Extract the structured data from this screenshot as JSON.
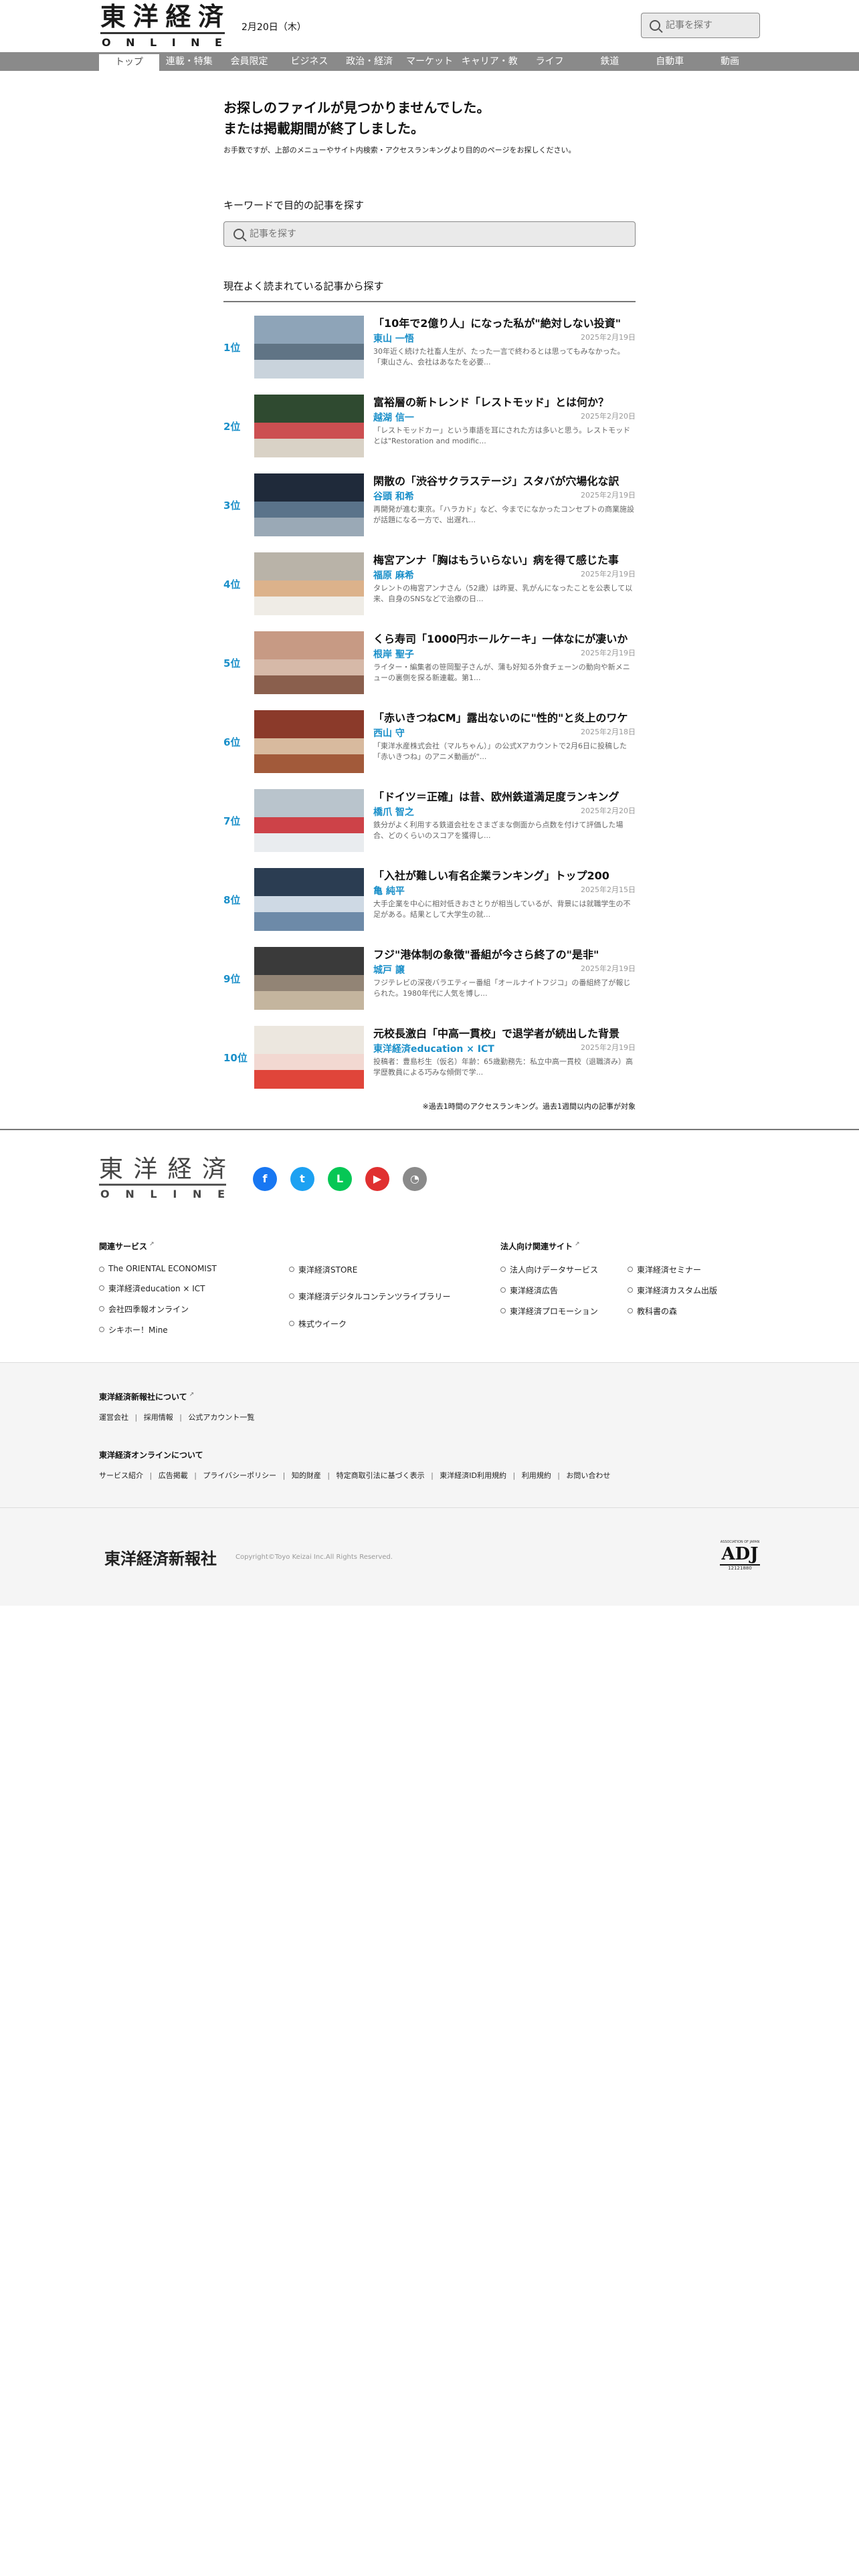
{
  "header": {
    "logo_kanji": [
      "東",
      "洋",
      "経",
      "済"
    ],
    "logo_latin": [
      "O",
      "N",
      "L",
      "I",
      "N",
      "E"
    ],
    "date": "2月20日（木）",
    "search_placeholder": "記事を探す"
  },
  "nav": {
    "items": [
      "トップ",
      "連載・特集",
      "会員限定",
      "ビジネス",
      "政治・経済",
      "マーケット",
      "キャリア・教育",
      "ライフ",
      "鉄道",
      "自動車",
      "動画"
    ],
    "active": 0
  },
  "main": {
    "error_title_1": "お探しのファイルが見つかりませんでした。",
    "error_title_2": "または掲載期間が終了しました。",
    "error_desc": "お手数ですが、上部のメニューやサイト内検索・アクセスランキングより目的のページをお探しください。",
    "keyword_title": "キーワードで目的の記事を探す",
    "search_placeholder": "記事を探す",
    "ranking_title": "現在よく読まれている記事から探す",
    "ranking_note": "※過去1時間のアクセスランキング。過去1週間以内の記事が対象"
  },
  "ranking": [
    {
      "rank": "1位",
      "title": "「10年で2億り人」になった私が\"絶対しない投資\"",
      "author": "東山 一悟",
      "date": "2025年2月19日",
      "excerpt": "30年近く続けた社畜人生が、たった一言で終わるとは思ってもみなかった。「東山さん、会社はあなたを必要...",
      "colors": [
        "#8ea4b8",
        "#4e6376",
        "#c9d3dc"
      ]
    },
    {
      "rank": "2位",
      "title": "富裕層の新トレンド「レストモッド」とは何か？",
      "author": "越湖 信一",
      "date": "2025年2月20日",
      "excerpt": "「レストモッドカー」という車語を耳にされた方は多いと思う。レストモッドとは\"Restoration and modific...",
      "colors": [
        "#2f4a30",
        "#c9383c",
        "#d9d2c6"
      ]
    },
    {
      "rank": "3位",
      "title": "閑散の「渋谷サクラステージ」スタバが穴場化な訳",
      "author": "谷頭 和希",
      "date": "2025年2月19日",
      "excerpt": "再開発が進む東京。「ハラカド」など、今までになかったコンセプトの商業施設が話題になる一方で、出遅れ...",
      "colors": [
        "#1f2a3a",
        "#4f6a82",
        "#9aa9b6"
      ]
    },
    {
      "rank": "4位",
      "title": "梅宮アンナ「胸はもういらない」病を得て感じた事",
      "author": "福原 麻希",
      "date": "2025年2月19日",
      "excerpt": "タレントの梅宮アンナさん（52歳）は昨夏、乳がんになったことを公表して以来、自身のSNSなどで治療の日...",
      "colors": [
        "#b9b3a8",
        "#d8a87a",
        "#efece6"
      ]
    },
    {
      "rank": "5位",
      "title": "くら寿司「1000円ホールケーキ」一体なにが凄いか",
      "author": "根岸 聖子",
      "date": "2025年2月19日",
      "excerpt": "ライター・編集者の笹岡聖子さんが、蒲も好知る外食チェーンの動向や新メニューの裏側を探る新連載。第1...",
      "colors": [
        "#c79a84",
        "#e3c9b9",
        "#8a5f4d"
      ]
    },
    {
      "rank": "6位",
      "title": "「赤いきつねCM」露出ないのに\"性的\"と炎上のワケ",
      "author": "西山 守",
      "date": "2025年2月18日",
      "excerpt": "「東洋水産株式会社（マルちゃん）」の公式Xアカウントで2月6日に投稿した「赤いきつね」のアニメ動画が\"...",
      "colors": [
        "#8b3a2a",
        "#e2cbb0",
        "#a25a3a"
      ]
    },
    {
      "rank": "7位",
      "title": "「ドイツ＝正確」は昔、欧州鉄道満足度ランキング",
      "author": "橋爪 智之",
      "date": "2025年2月20日",
      "excerpt": "鉄分がよく利用する鉄道会社をさまざまな側面から点数を付けて評価した場合、どのくらいのスコアを獲得し...",
      "colors": [
        "#b9c4cc",
        "#c8242a",
        "#e9ecef"
      ]
    },
    {
      "rank": "8位",
      "title": "「入社が難しい有名企業ランキング」トップ200",
      "author": "亀 純平",
      "date": "2025年2月15日",
      "excerpt": "大手企業を中心に相対低きおさとりが相当しているが、背景には就職学生の不足がある。結果として大学生の就...",
      "colors": [
        "#2b3d52",
        "#dfe6ee",
        "#6d8aa8"
      ]
    },
    {
      "rank": "9位",
      "title": "フジ\"港体制の象徴\"番組が今さら終了の\"是非\"",
      "author": "城戸 譲",
      "date": "2025年2月19日",
      "excerpt": "フジテレビの深夜バラエティー番組「オールナイトフジコ」の番組終了が報じられた。1980年代に人気を博し...",
      "colors": [
        "#3a3a3a",
        "#8a7b6d",
        "#c4b59e"
      ]
    },
    {
      "rank": "10位",
      "title": "元校長激白「中高一貫校」で退学者が続出した背景",
      "author": "東洋経済education × ICT",
      "date": "2025年2月19日",
      "excerpt": "投稿者：豊島杉生（仮名）年齢：65歳勤務先：私立中高一貫校（退職済み）高学歴教員による巧みな傾倒で学...",
      "colors": [
        "#ece7df",
        "#f5f2ec",
        "#e0453a"
      ]
    }
  ],
  "footer": {
    "logo_kanji": [
      "東",
      "洋",
      "経",
      "済"
    ],
    "logo_latin": [
      "O",
      "N",
      "L",
      "I",
      "N",
      "E"
    ],
    "social": [
      {
        "icon": "facebook-icon",
        "glyph": "f",
        "color": "#1877f2"
      },
      {
        "icon": "twitter-icon",
        "glyph": "t",
        "color": "#1da1f2"
      },
      {
        "icon": "line-icon",
        "glyph": "L",
        "color": "#06c755"
      },
      {
        "icon": "youtube-icon",
        "glyph": "▶",
        "color": "#e03030"
      },
      {
        "icon": "rss-icon",
        "glyph": "◔",
        "color": "#8a8a8a"
      }
    ],
    "related_title": "関連サービス",
    "related_col1": [
      "The ORIENTAL ECONOMIST",
      "東洋経済education × ICT",
      "会社四季報オンライン",
      "シキホー！Mine"
    ],
    "related_col2": [
      "東洋経済STORE",
      "東洋経済デジタルコンテンツライブラリー",
      "株式ウイーク"
    ],
    "corp_title": "法人向け関連サイト",
    "corp_col1": [
      "法人向けデータサービス",
      "東洋経済広告",
      "東洋経済プロモーション"
    ],
    "corp_col2": [
      "東洋経済セミナー",
      "東洋経済カスタム出版",
      "教科書の森"
    ],
    "about_title": "東洋経済新報社について",
    "about_links": [
      "運営会社",
      "採用情報",
      "公式アカウント一覧"
    ],
    "online_title": "東洋経済オンラインについて",
    "online_links": [
      "サービス紹介",
      "広告掲載",
      "プライバシーポリシー",
      "知的財産",
      "特定商取引法に基づく表示",
      "東洋経済ID利用規約",
      "利用規約",
      "お問い合わせ"
    ],
    "company": "東洋経済新報社",
    "copyright": "Copyright©Toyo Keizai Inc.All Rights Reserved.",
    "adj_top": "ASSOCIATION OF JAPAN",
    "adj_mark": "ADJ",
    "adj_num": "12121880"
  }
}
